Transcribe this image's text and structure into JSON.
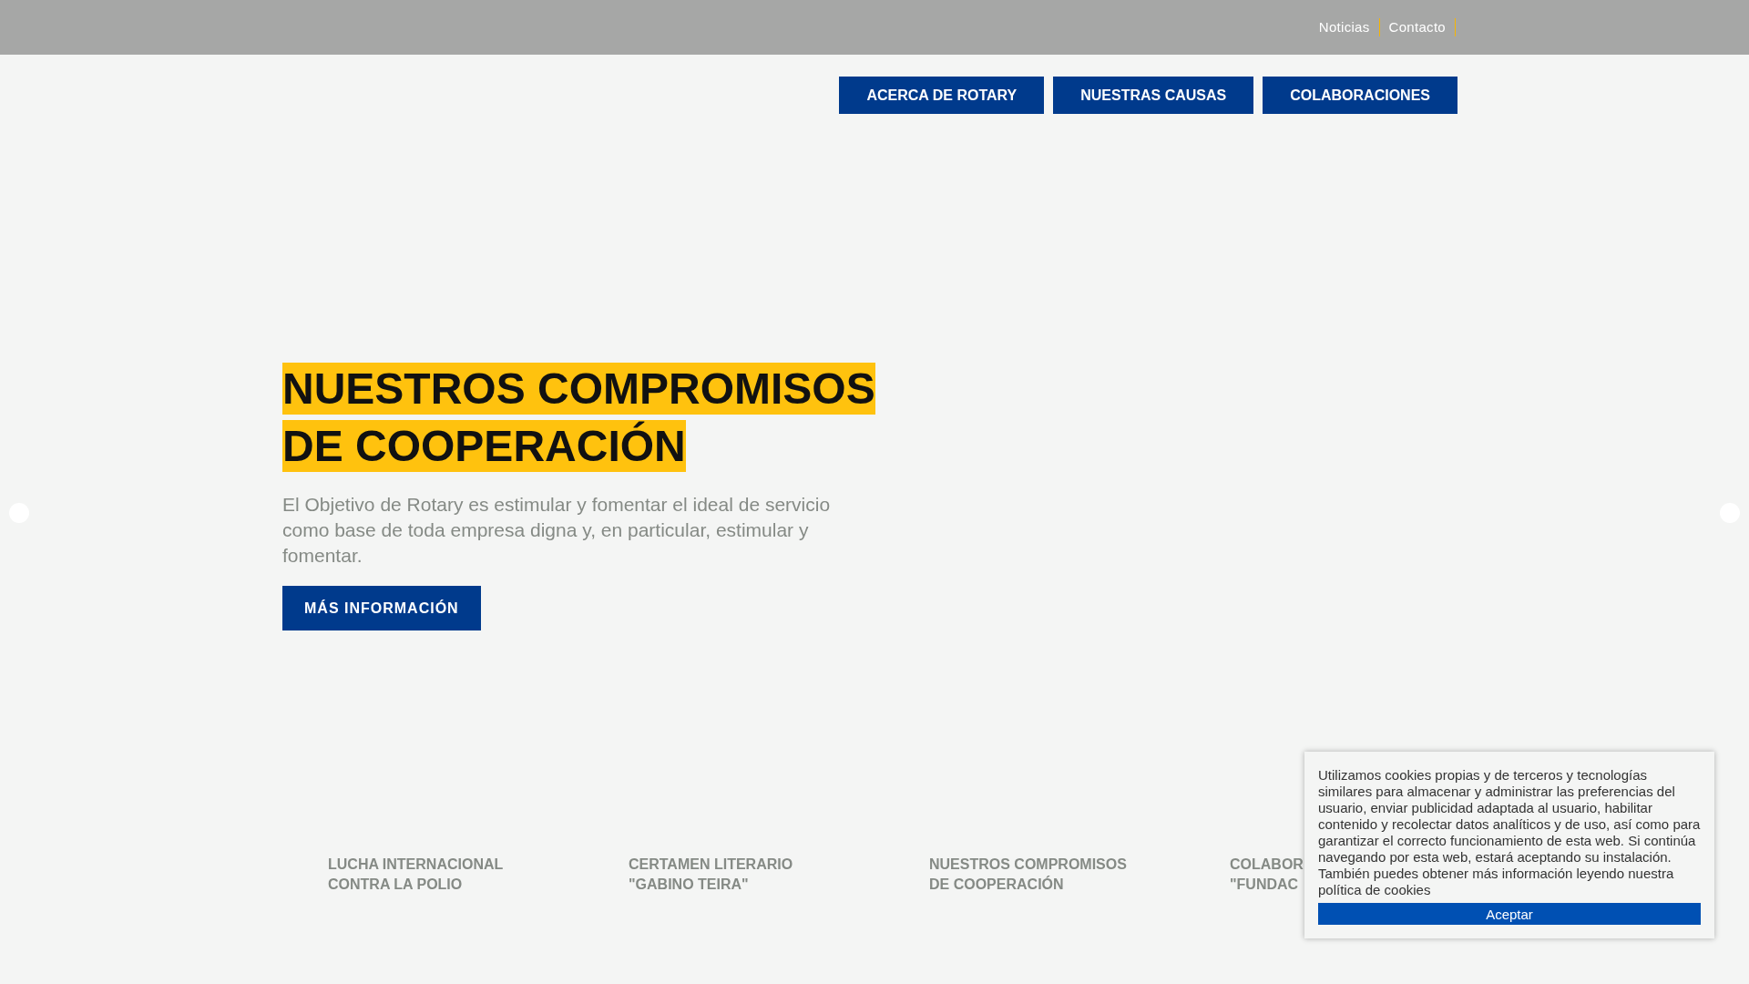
{
  "top_links": [
    {
      "label": "Noticias"
    },
    {
      "label": "Contacto"
    }
  ],
  "nav": [
    "ACERCA DE ROTARY",
    "NUESTRAS CAUSAS",
    "COLABORACIONES"
  ],
  "slide": {
    "title_lines": [
      "NUESTROS COMPROMISOS",
      "DE COOPERACIÓN"
    ],
    "text": "El Objetivo de Rotary es estimular y fomentar el ideal de servicio como base de toda empresa digna y, en particular, estimular y fomentar.",
    "button": "MÁS INFORMACIÓN"
  },
  "slide_labels": [
    {
      "lines": [
        "LUCHA INTERNACIONAL",
        "CONTRA LA POLIO"
      ]
    },
    {
      "lines": [
        "CERTAMEN LITERARIO",
        "\"GABINO TEIRA\""
      ]
    },
    {
      "lines": [
        "NUESTROS COMPROMISOS",
        "DE COOPERACIÓN"
      ]
    },
    {
      "lines": [
        "COLABOR",
        "\"FUNDAC"
      ]
    }
  ],
  "cookie": {
    "text": "Utilizamos cookies propias y de terceros y tecnologías similares para almacenar y administrar las preferencias del usuario, enviar publicidad adaptada al usuario, habilitar contenido y recolectar datos analíticos y de uso, así como para garantizar el correcto funcionamiento de esta web. Si continúa navegando por esta web, estará aceptando su instalación. También puedes obtener más información leyendo nuestra política de cookies",
    "button": "Aceptar"
  }
}
